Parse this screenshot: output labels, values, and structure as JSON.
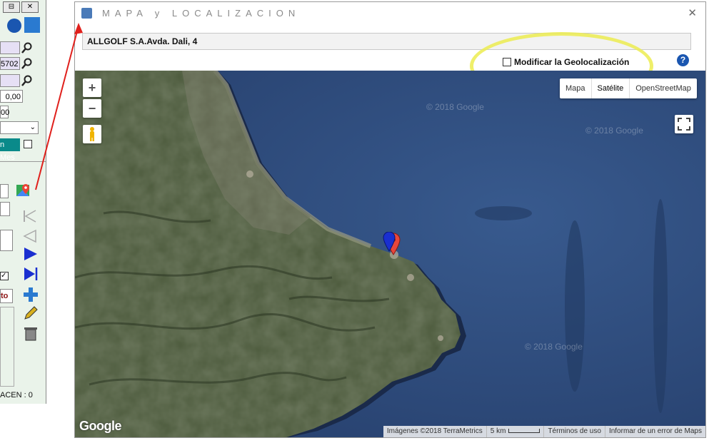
{
  "background_app": {
    "min_btn": "⊟",
    "close_btn": "✕",
    "field_1": "",
    "field_2": "5702",
    "field_3": "",
    "field_4": "0,00",
    "field_5": "00",
    "mes_button": "n Mes",
    "red_label": "to",
    "footer": "ACEN : 0"
  },
  "window": {
    "title": "MAPA y LOCALIZACION",
    "close_glyph": "✕",
    "address": "ALLGOLF S.A.Avda. Dali, 4",
    "geo_checkbox_label": "Modificar la Geolocalización",
    "geo_checked": false,
    "help_glyph": "?"
  },
  "map": {
    "zoom_in": "+",
    "zoom_out": "−",
    "map_types": [
      "Mapa",
      "Satélite",
      "OpenStreetMap"
    ],
    "active_map_type": "Satélite",
    "watermark": "© 2018 Google",
    "logo": "Google",
    "attribution": {
      "imagery": "Imágenes ©2018 TerraMetrics",
      "scale": "5 km",
      "terms": "Términos de uso",
      "report": "Informar de un error de Maps"
    }
  },
  "colors": {
    "highlight": "#ecec50",
    "sea": "#2e4f83",
    "land": "#4c5a3c",
    "marker_red": "#e8463c",
    "marker_blue": "#1a2fd0",
    "arrow": "#e0201c"
  }
}
